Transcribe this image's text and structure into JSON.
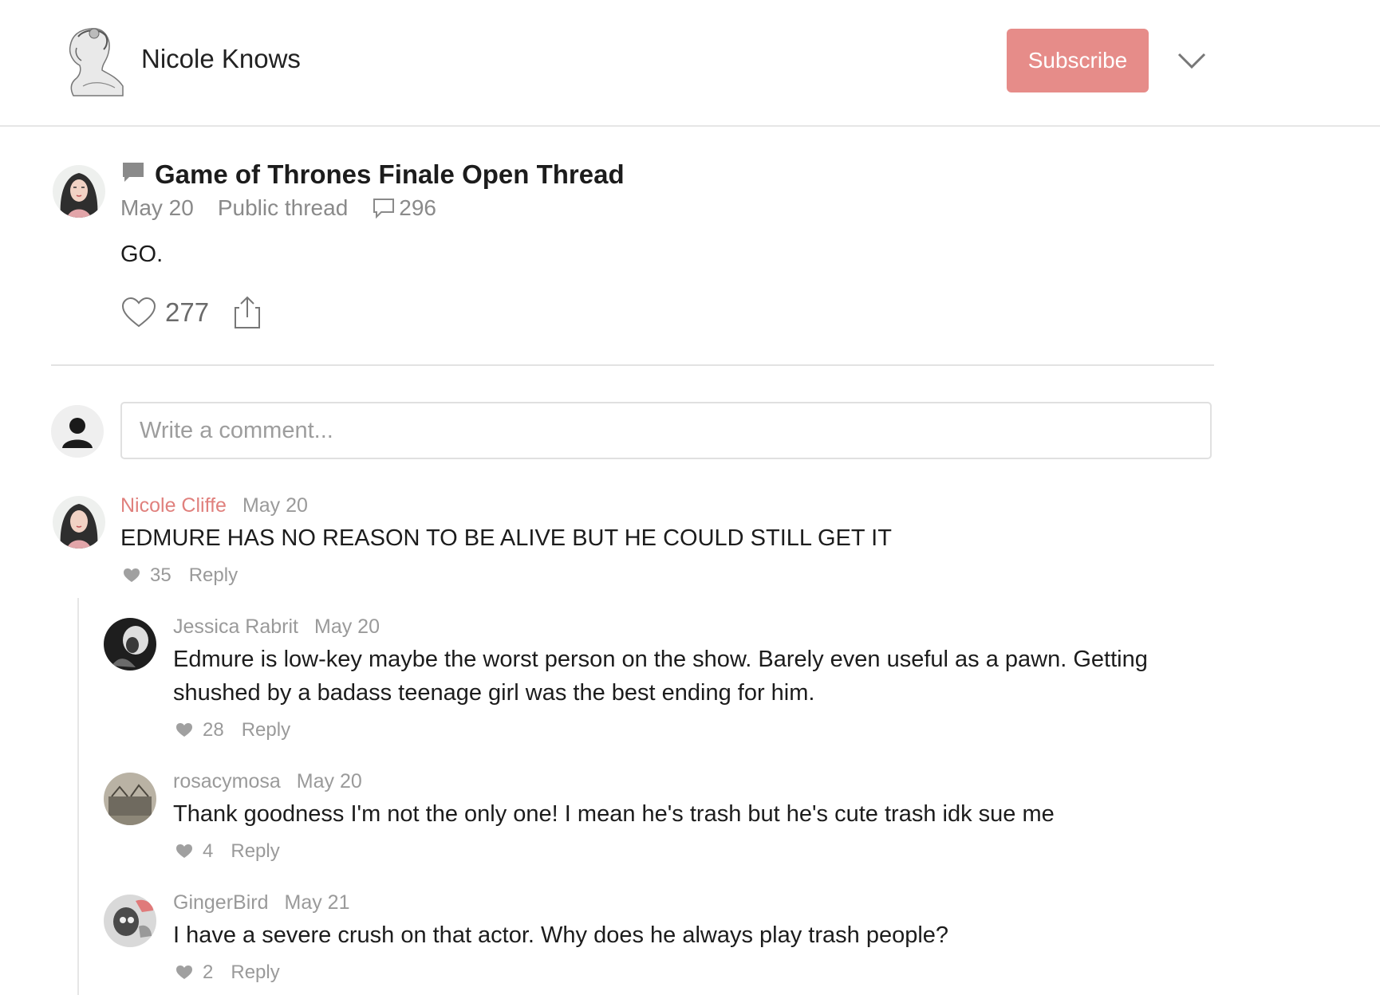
{
  "header": {
    "site_title": "Nicole Knows",
    "subscribe_label": "Subscribe",
    "accent_color": "#e68c89"
  },
  "post": {
    "title": "Game of Thrones Finale Open Thread",
    "date": "May 20",
    "visibility": "Public thread",
    "comment_count": "296",
    "body": "GO.",
    "like_count": "277",
    "icons": [
      "thread-icon",
      "comment-bubble-icon",
      "heart-icon",
      "share-icon"
    ]
  },
  "composer": {
    "placeholder": "Write a comment..."
  },
  "comments": [
    {
      "author": "Nicole Cliffe",
      "date": "May 20",
      "text": "EDMURE HAS NO REASON TO BE ALIVE BUT HE COULD STILL GET IT",
      "likes": "35",
      "reply_label": "Reply"
    },
    {
      "author": "Jessica Rabrit",
      "date": "May 20",
      "text": "Edmure is low-key maybe the worst person on the show. Barely even useful as a pawn. Getting shushed by a badass teenage girl was the best ending for him.",
      "likes": "28",
      "reply_label": "Reply"
    },
    {
      "author": "rosacymosa",
      "date": "May 20",
      "text": "Thank goodness I'm not the only one! I mean he's trash but he's cute trash idk sue me",
      "likes": "4",
      "reply_label": "Reply"
    },
    {
      "author": "GingerBird",
      "date": "May 21",
      "text": "I have a severe crush on that actor. Why does he always play trash people?",
      "likes": "2",
      "reply_label": "Reply"
    }
  ]
}
